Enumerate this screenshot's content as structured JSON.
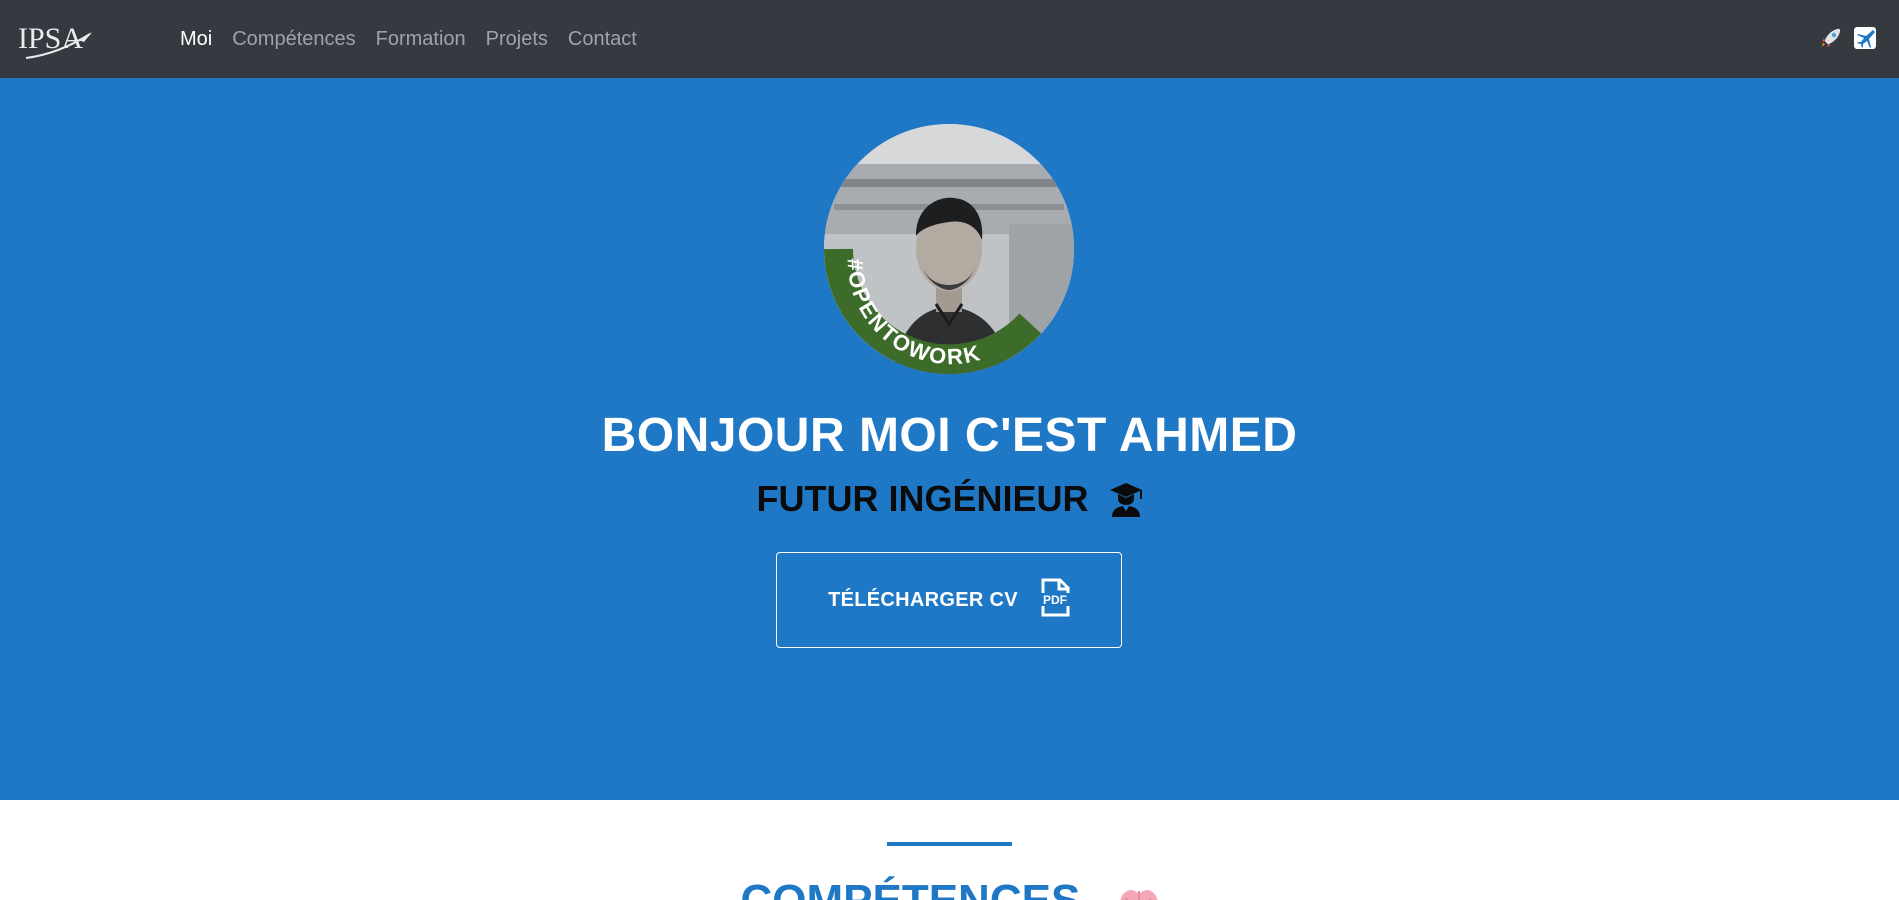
{
  "nav": {
    "brand_text": "IPSA",
    "brand_icon": "ipsa-logo",
    "links": [
      {
        "label": "Moi",
        "active": true
      },
      {
        "label": "Compétences",
        "active": false
      },
      {
        "label": "Formation",
        "active": false
      },
      {
        "label": "Projets",
        "active": false
      },
      {
        "label": "Contact",
        "active": false
      }
    ],
    "icons": [
      "rocket-icon",
      "airplane-icon"
    ]
  },
  "hero": {
    "avatar_badge": "#OPENTOWORK",
    "title": "BONJOUR MOI C'EST AHMED",
    "subtitle": "FUTUR INGÉNIEUR",
    "subtitle_icon": "graduate-icon",
    "cv_button": "TÉLÉCHARGER CV",
    "cv_icon": "pdf-file-icon"
  },
  "section": {
    "title": "COMPÉTENCES",
    "title_icon": "brain-icon"
  },
  "colors": {
    "navbar": "#343a40",
    "hero": "#1f78c6",
    "accent": "#1f78c6",
    "badge": "#3d6b2a"
  }
}
